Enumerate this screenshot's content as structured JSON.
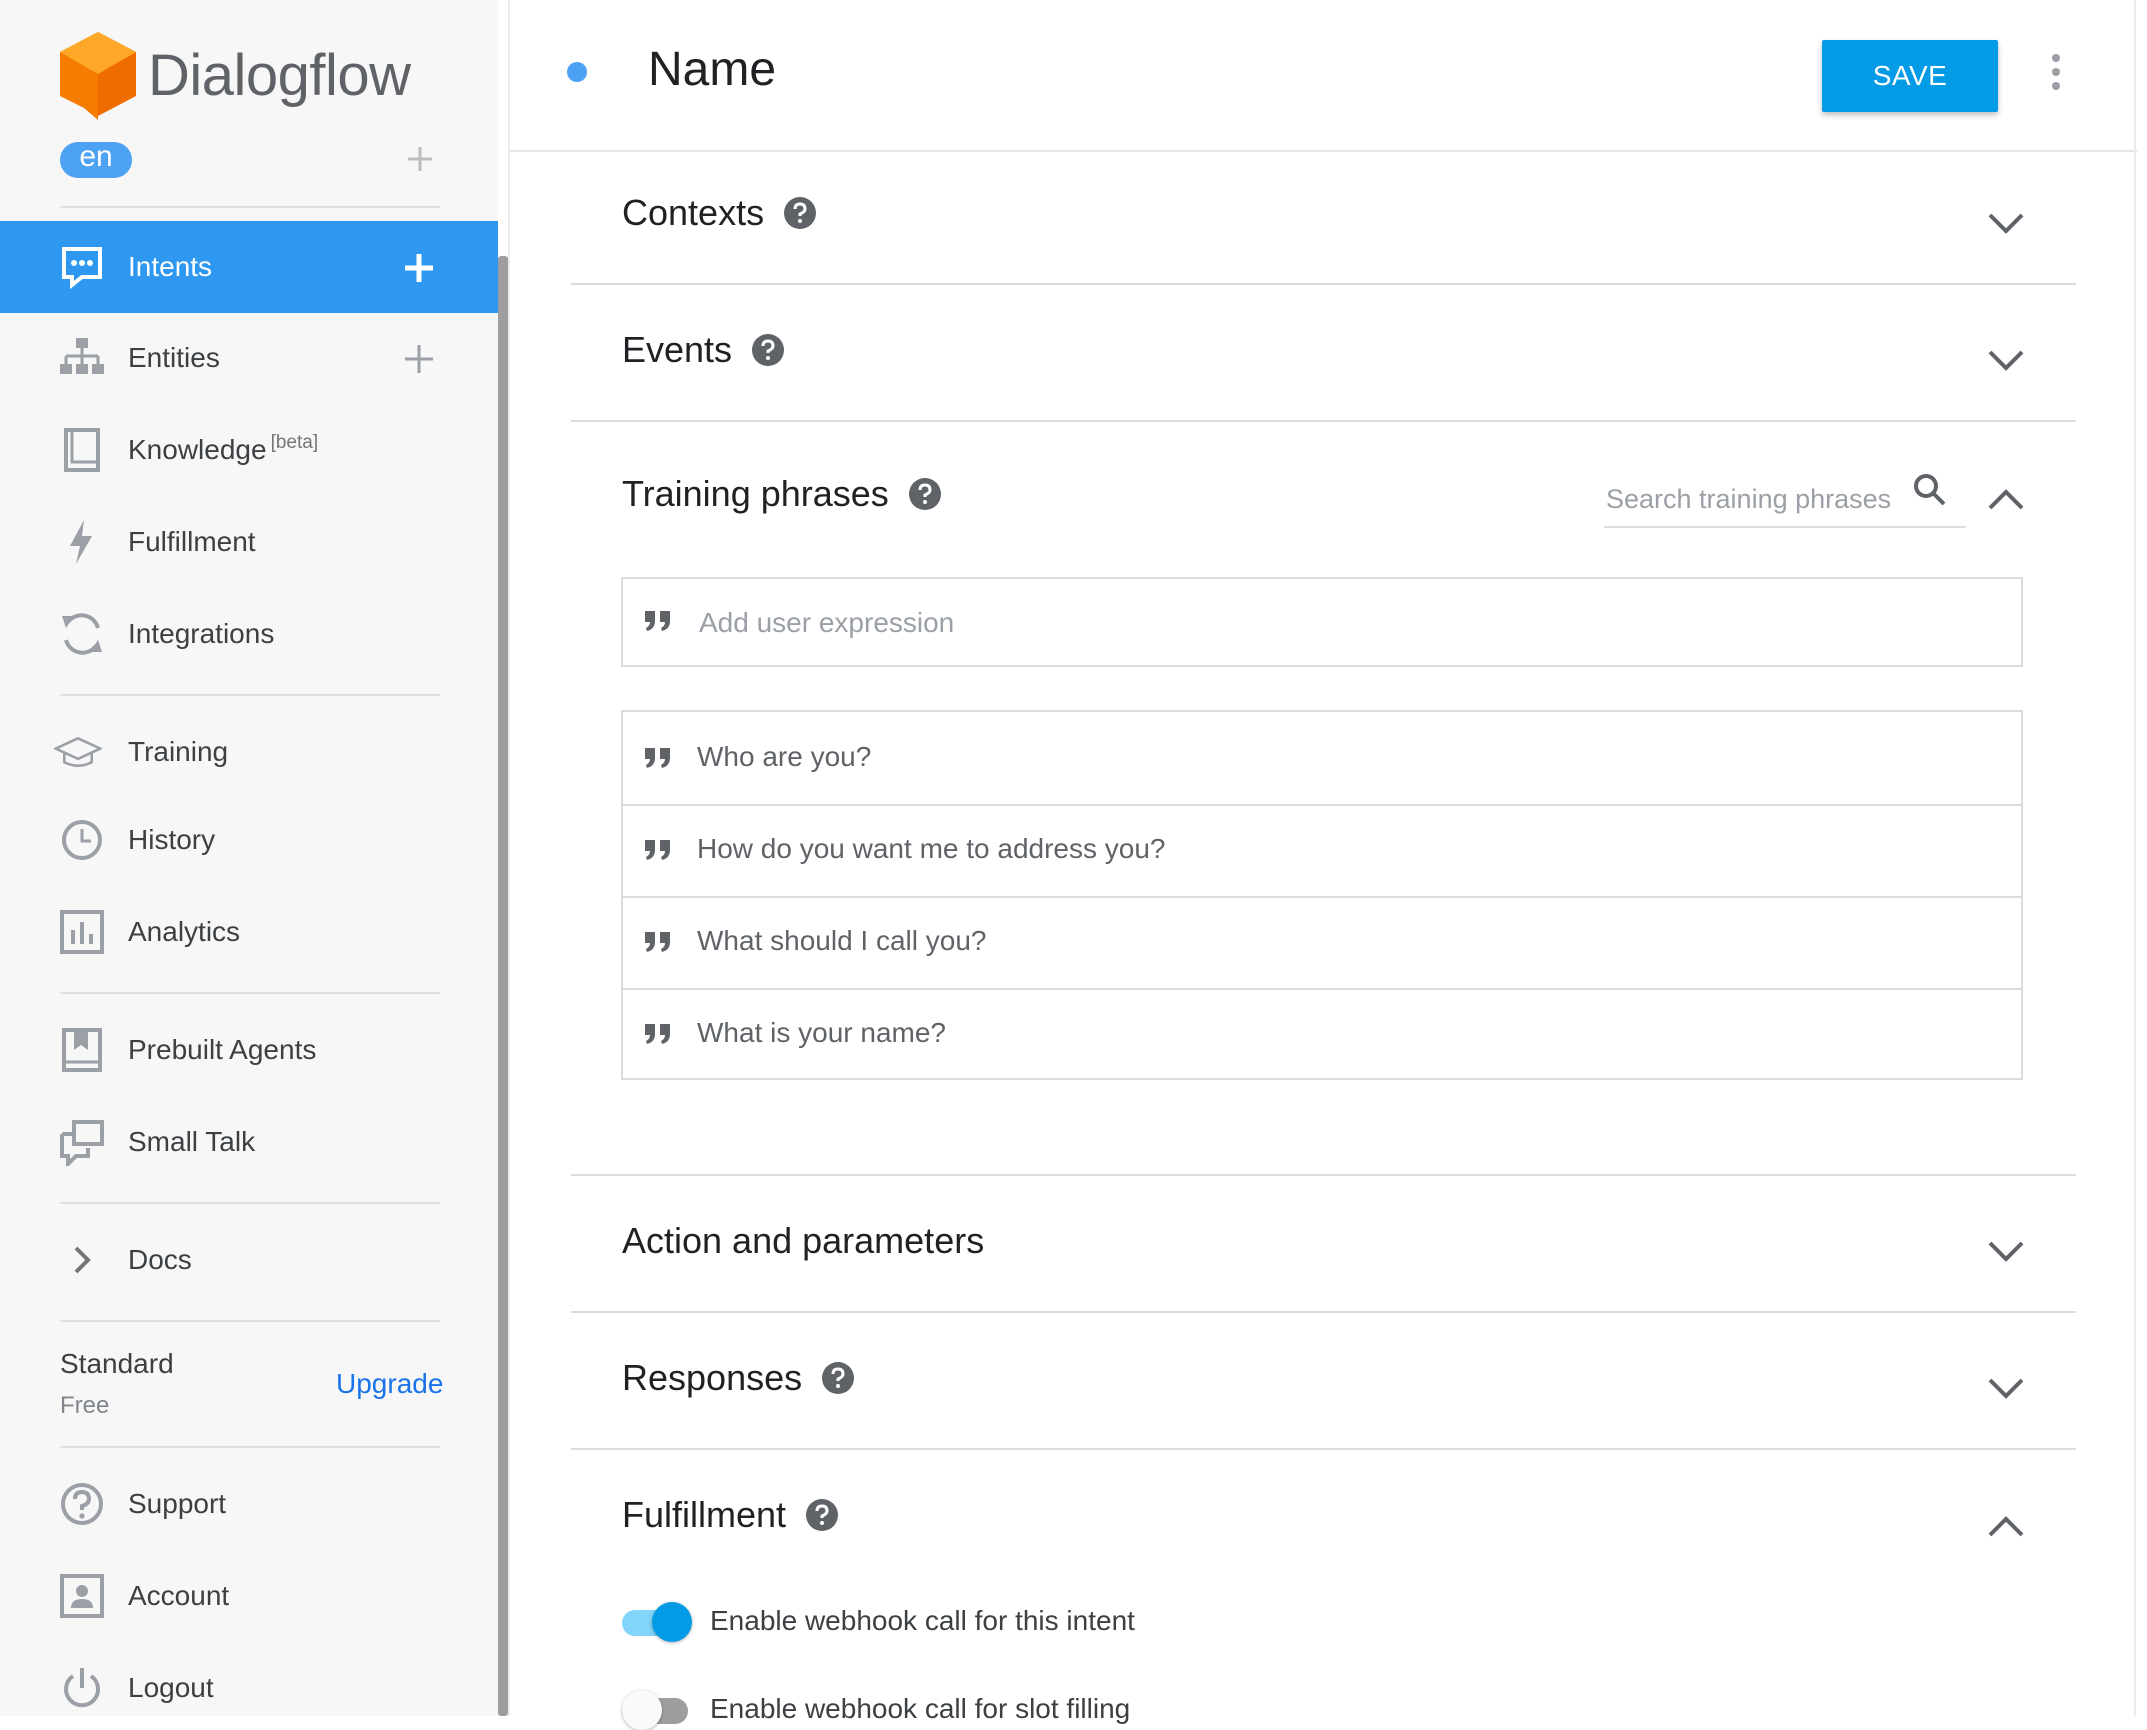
{
  "app": {
    "name": "Dialogflow",
    "language": "en"
  },
  "sidebar": {
    "items": [
      {
        "id": "intents",
        "label": "Intents",
        "icon": "intents-icon",
        "active": true,
        "add": true
      },
      {
        "id": "entities",
        "label": "Entities",
        "icon": "entities-icon",
        "add": true
      },
      {
        "id": "knowledge",
        "label": "Knowledge",
        "badge": "[beta]",
        "icon": "knowledge-icon"
      },
      {
        "id": "fulfillment",
        "label": "Fulfillment",
        "icon": "lightning-icon"
      },
      {
        "id": "integrations",
        "label": "Integrations",
        "icon": "integrations-icon"
      },
      {
        "id": "training",
        "label": "Training",
        "icon": "graduation-cap-icon"
      },
      {
        "id": "history",
        "label": "History",
        "icon": "clock-icon"
      },
      {
        "id": "analytics",
        "label": "Analytics",
        "icon": "bar-chart-icon"
      },
      {
        "id": "prebuilt-agents",
        "label": "Prebuilt Agents",
        "icon": "prebuilt-agents-icon"
      },
      {
        "id": "small-talk",
        "label": "Small Talk",
        "icon": "chat-bubbles-icon"
      },
      {
        "id": "docs",
        "label": "Docs",
        "icon": "chevron-right-icon"
      },
      {
        "id": "support",
        "label": "Support",
        "icon": "help-circle-icon"
      },
      {
        "id": "account",
        "label": "Account",
        "icon": "account-icon"
      },
      {
        "id": "logout",
        "label": "Logout",
        "icon": "power-icon"
      }
    ],
    "plan": {
      "name": "Standard",
      "tier": "Free",
      "upgrade_label": "Upgrade"
    }
  },
  "header": {
    "intent_name": "Name",
    "save_label": "SAVE"
  },
  "sections": {
    "contexts": "Contexts",
    "events": "Events",
    "training_phrases": "Training phrases",
    "action_parameters": "Action and parameters",
    "responses": "Responses",
    "fulfillment": "Fulfillment"
  },
  "training": {
    "search_placeholder": "Search training phrases",
    "add_placeholder": "Add user expression",
    "phrases": [
      "Who are you?",
      "How do you want me to address you?",
      "What should I call you?",
      "What is your name?"
    ]
  },
  "fulfillment": {
    "webhook_label": "Enable webhook call for this intent",
    "webhook_enabled": true,
    "slot_filling_label": "Enable webhook call for slot filling",
    "slot_filling_enabled": false
  },
  "colors": {
    "accent": "#2e98f1",
    "save": "#039be5",
    "logo": "#ef6c00"
  }
}
